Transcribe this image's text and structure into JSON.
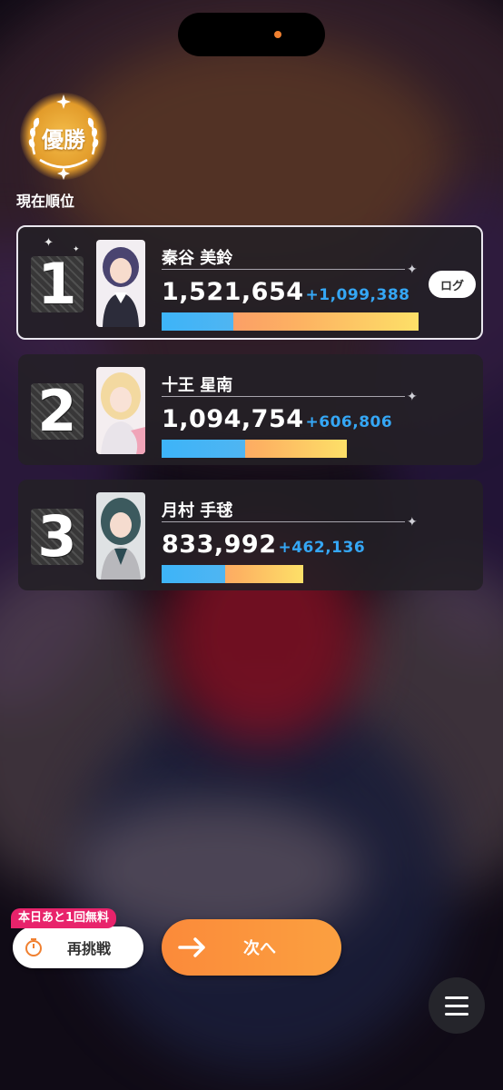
{
  "badge": {
    "label": "優勝",
    "caption": "現在順位"
  },
  "rankings": [
    {
      "rank": "1",
      "name": "秦谷 美鈴",
      "score": "1,521,654",
      "delta": "+1,099,388",
      "bar_fraction": 1.0,
      "blue_fraction": 0.28,
      "portrait_icon": "character-portrait-misuzu",
      "hair": "#4a4470"
    },
    {
      "rank": "2",
      "name": "十王 星南",
      "score": "1,094,754",
      "delta": "+606,806",
      "bar_fraction": 0.72,
      "blue_fraction": 0.45,
      "portrait_icon": "character-portrait-sena",
      "hair": "#f3d9a0"
    },
    {
      "rank": "3",
      "name": "月村 手毬",
      "score": "833,992",
      "delta": "+462,136",
      "bar_fraction": 0.55,
      "blue_fraction": 0.45,
      "portrait_icon": "character-portrait-temari",
      "hair": "#3c5a5e"
    }
  ],
  "log_button": {
    "label": "ログ"
  },
  "retry": {
    "tag": "本日あと1回無料",
    "label": "再挑戦",
    "icon": "stopwatch-icon"
  },
  "next": {
    "label": "次へ",
    "icon": "arrow-right-icon"
  },
  "menu": {
    "icon": "hamburger-menu-icon"
  },
  "colors": {
    "accent": "#fb8a3a",
    "delta": "#35a7f5",
    "free_tag": "#e8236b"
  }
}
